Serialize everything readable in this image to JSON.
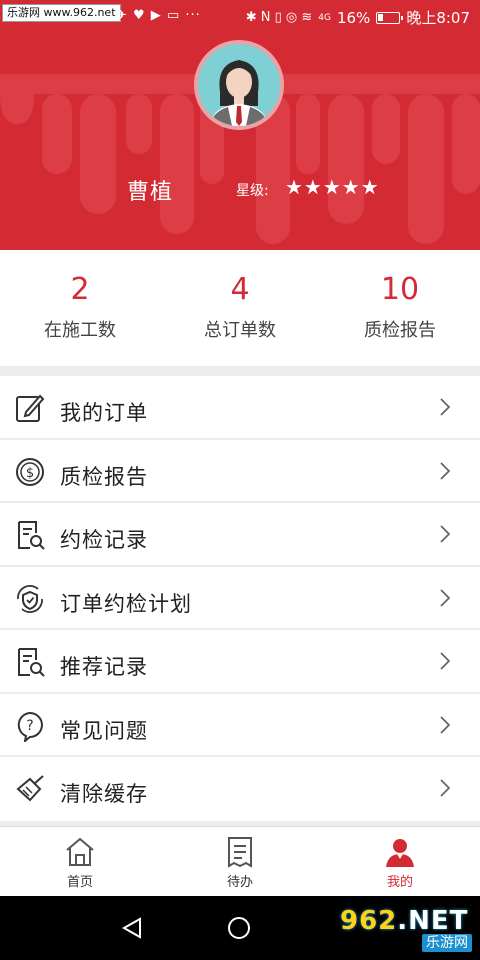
{
  "status_bar": {
    "watermark": "乐游网 www.962.net",
    "left_icons": "✈ ♥ ▶ ▭ ···",
    "signal_icons": "✱ N ▯ ◎ ≋",
    "network_badge": "4G",
    "battery_percent": "16%",
    "time": "晚上8:07"
  },
  "profile": {
    "name": "曹植",
    "star_label": "星级:",
    "stars": "★★★★★",
    "rating": 5
  },
  "stats": [
    {
      "value": "2",
      "label": "在施工数"
    },
    {
      "value": "4",
      "label": "总订单数"
    },
    {
      "value": "10",
      "label": "质检报告"
    }
  ],
  "menu": [
    {
      "label": "我的订单",
      "icon": "edit-icon"
    },
    {
      "label": "质检报告",
      "icon": "dollar-circle-icon"
    },
    {
      "label": "约检记录",
      "icon": "document-search-icon"
    },
    {
      "label": "订单约检计划",
      "icon": "shield-cycle-icon"
    },
    {
      "label": "推荐记录",
      "icon": "document-search-icon"
    },
    {
      "label": "常见问题",
      "icon": "question-icon"
    },
    {
      "label": "清除缓存",
      "icon": "broom-icon"
    }
  ],
  "tabs": [
    {
      "label": "首页",
      "icon": "home-icon",
      "active": false
    },
    {
      "label": "待办",
      "icon": "todo-list-icon",
      "active": false
    },
    {
      "label": "我的",
      "icon": "user-icon",
      "active": true
    }
  ],
  "brand": {
    "logo_top_hl": "962",
    "logo_top_rest": ".NET",
    "logo_bottom": "乐游网"
  },
  "colors": {
    "accent": "#d42a33",
    "background": "#ececec",
    "text": "#333333"
  }
}
